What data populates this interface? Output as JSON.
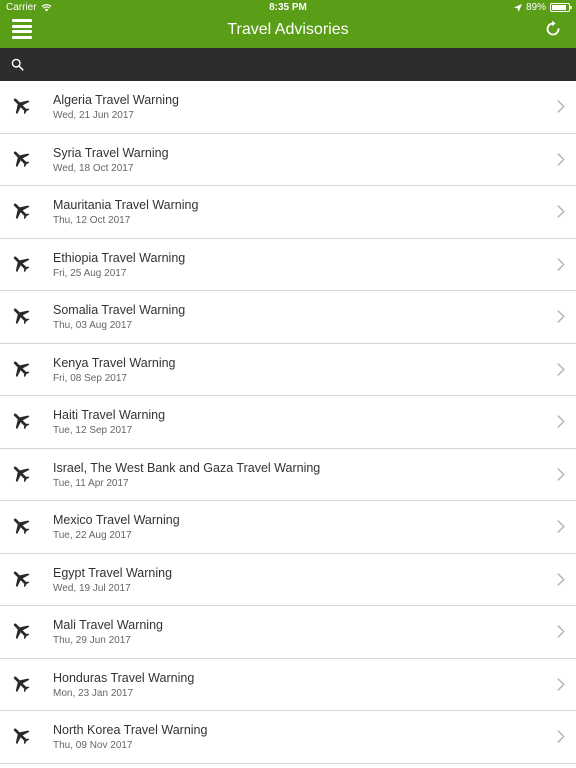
{
  "status": {
    "carrier": "Carrier",
    "time": "8:35 PM",
    "battery": "89%",
    "battery_level": 0.89
  },
  "nav": {
    "title": "Travel Advisories"
  },
  "search": {
    "placeholder": ""
  },
  "items": [
    {
      "title": "Algeria Travel Warning",
      "date": "Wed, 21 Jun 2017"
    },
    {
      "title": "Syria Travel Warning",
      "date": "Wed, 18 Oct 2017"
    },
    {
      "title": "Mauritania Travel Warning",
      "date": "Thu, 12 Oct 2017"
    },
    {
      "title": "Ethiopia Travel Warning",
      "date": "Fri, 25 Aug 2017"
    },
    {
      "title": "Somalia Travel Warning",
      "date": "Thu, 03 Aug 2017"
    },
    {
      "title": "Kenya Travel Warning",
      "date": "Fri, 08 Sep 2017"
    },
    {
      "title": "Haiti Travel Warning",
      "date": "Tue, 12 Sep 2017"
    },
    {
      "title": "Israel, The West Bank and Gaza Travel Warning",
      "date": "Tue, 11 Apr 2017"
    },
    {
      "title": "Mexico Travel Warning",
      "date": "Tue, 22 Aug 2017"
    },
    {
      "title": "Egypt Travel Warning",
      "date": "Wed, 19 Jul 2017"
    },
    {
      "title": "Mali Travel Warning",
      "date": "Thu, 29 Jun 2017"
    },
    {
      "title": "Honduras Travel Warning",
      "date": "Mon, 23 Jan 2017"
    },
    {
      "title": "North Korea Travel Warning",
      "date": "Thu, 09 Nov 2017"
    }
  ],
  "colors": {
    "header": "#5a9e18",
    "searchbar": "#2d2d2d",
    "divider": "#d4d4d4"
  },
  "icons": {
    "menu": "menu-icon",
    "refresh": "refresh-icon",
    "search": "search-icon",
    "item": "airplane-icon",
    "chevron": "chevron-right-icon"
  }
}
